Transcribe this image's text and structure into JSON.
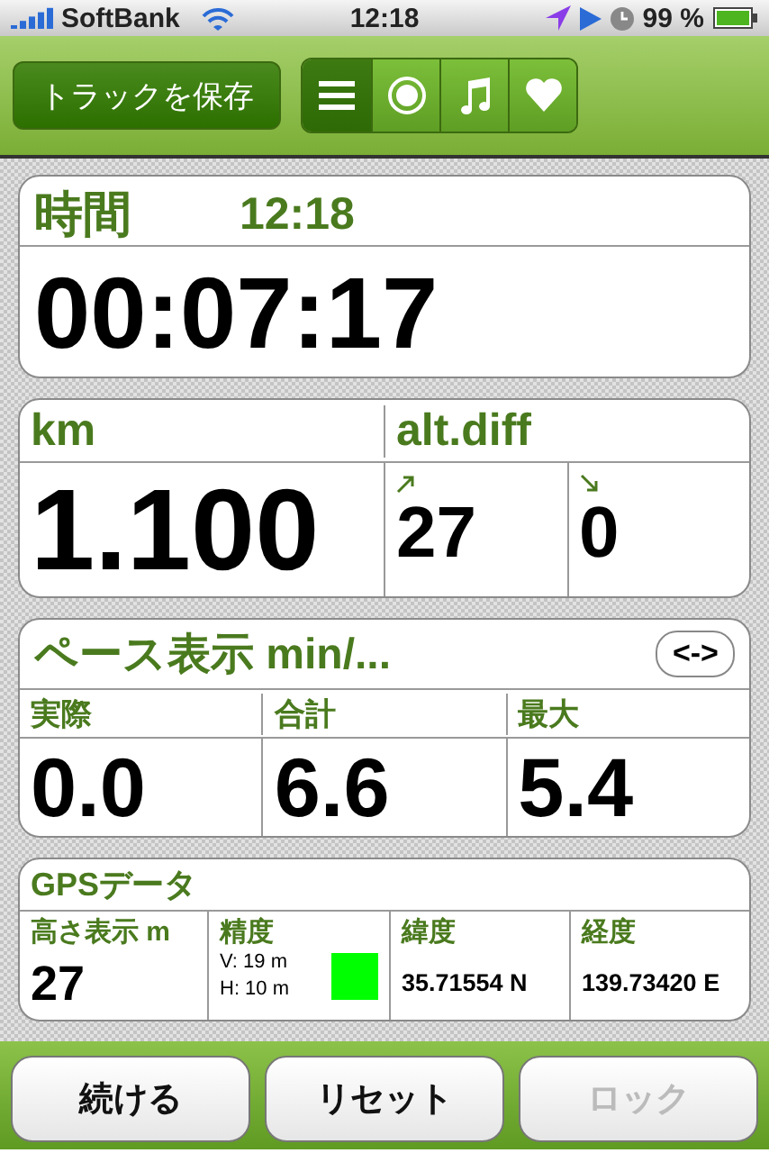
{
  "status_bar": {
    "carrier": "SoftBank",
    "time": "12:18",
    "battery": "99 %"
  },
  "toolbar": {
    "save_button": "トラックを保存",
    "segments": [
      {
        "kind": "menu",
        "selected": true
      },
      {
        "kind": "record",
        "selected": false
      },
      {
        "kind": "music",
        "selected": false
      },
      {
        "kind": "heart",
        "selected": false
      }
    ]
  },
  "time_card": {
    "label": "時間",
    "clock": "12:18",
    "elapsed": "00:07:17"
  },
  "distance_card": {
    "label": "km",
    "value": "1.100",
    "alt_label": "alt.diff",
    "ascent": "27",
    "descent": "0"
  },
  "pace_card": {
    "title": "ペース表示 min/...",
    "toggle": "<->",
    "columns": [
      {
        "label": "実際",
        "value": "0.0"
      },
      {
        "label": "合計",
        "value": "6.6"
      },
      {
        "label": "最大",
        "value": "5.4"
      }
    ]
  },
  "gps_card": {
    "title": "GPSデータ",
    "altitude_label": "高さ表示 m",
    "altitude": "27",
    "accuracy_label": "精度",
    "vertical": "V: 19 m",
    "horizontal": "H: 10 m",
    "signal_indicator": {
      "color": "#00ff00"
    },
    "latitude_label": "緯度",
    "latitude": "35.71554 N",
    "longitude_label": "経度",
    "longitude": "139.73420 E"
  },
  "buttons": [
    {
      "label": "続ける",
      "disabled": false
    },
    {
      "label": "リセット",
      "disabled": false
    },
    {
      "label": "ロック",
      "disabled": true
    }
  ]
}
